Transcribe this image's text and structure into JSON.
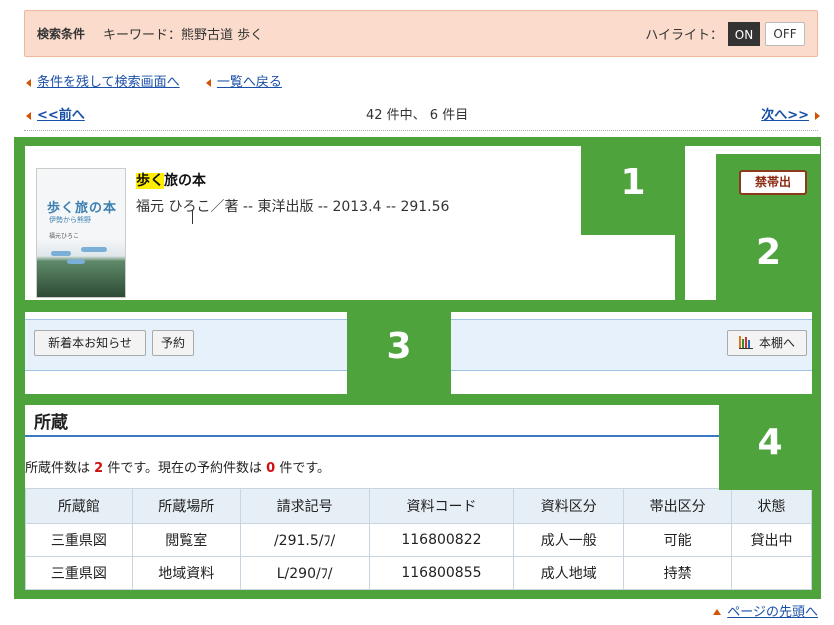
{
  "search": {
    "label": "検索条件",
    "keyword": "キーワード：熊野古道 歩く",
    "highlight_label": "ハイライト：",
    "on": "ON",
    "off": "OFF"
  },
  "nav": {
    "back_to_search": "条件を残して検索画面へ",
    "back_to_list": "一覧へ戻る",
    "prev": "<<前へ",
    "count": "42 件中、 6 件目",
    "next": "次へ>>"
  },
  "book": {
    "title_highlight": "歩く",
    "title_rest": "旅の本",
    "meta": "福元 ひろこ／著 -- 東洋出版 -- 2013.4 -- 291.56",
    "cover_title": "歩く旅の本",
    "cover_subtitle": "伊勢から熊野",
    "cover_author": "福元ひろこ"
  },
  "badge": "禁帯出",
  "annotations": [
    "1",
    "2",
    "3",
    "4"
  ],
  "actions": {
    "new_arrivals": "新着本お知らせ",
    "reserve": "予約",
    "bookshelf": "本棚へ"
  },
  "holdings": {
    "title": "所蔵",
    "count_prefix": "所蔵件数は ",
    "count": "2",
    "count_mid": " 件です。現在の予約件数は ",
    "reserve_count": "0",
    "count_suffix": " 件です。",
    "columns": [
      "所蔵館",
      "所蔵場所",
      "請求記号",
      "資料コード",
      "資料区分",
      "帯出区分",
      "状態"
    ],
    "rows": [
      [
        "三重県図",
        "閲覧室",
        "/291.5/ﾌ/",
        "116800822",
        "成人一般",
        "可能",
        "貸出中"
      ],
      [
        "三重県図",
        "地域資料",
        "L/290/ﾌ/",
        "116800855",
        "成人地域",
        "持禁",
        ""
      ]
    ]
  },
  "page_top": "ページの先頭へ",
  "colors": {
    "annotation_green": "#4ea33c",
    "link": "#1a4fa8",
    "accent_orange": "#d35400",
    "highlight_yellow": "#ffee00",
    "count_red": "#d01010"
  }
}
